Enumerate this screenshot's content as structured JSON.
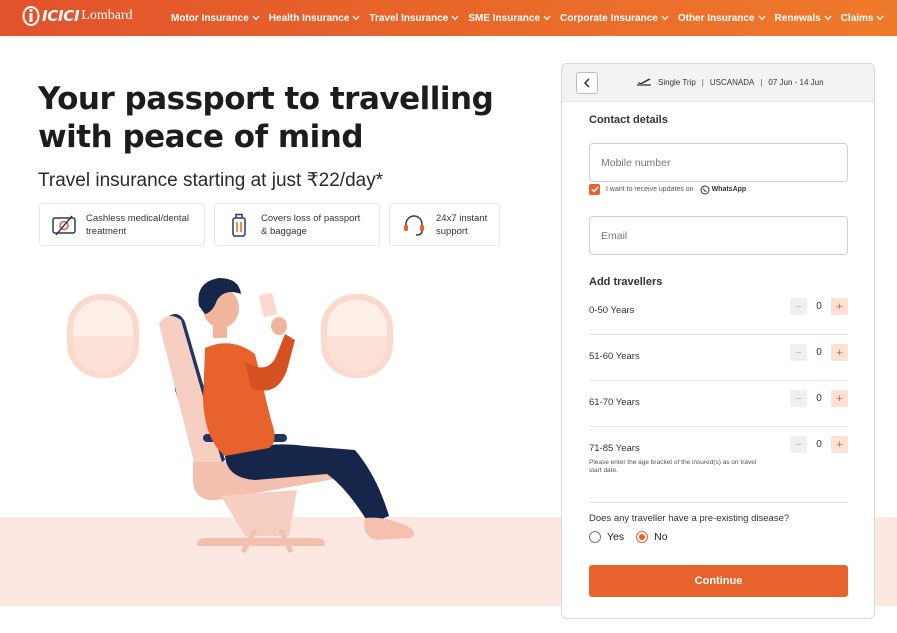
{
  "brand": {
    "name": "ICICI",
    "sub": "Lombard"
  },
  "nav": {
    "items": [
      {
        "label": "Motor Insurance"
      },
      {
        "label": "Health Insurance"
      },
      {
        "label": "Travel Insurance"
      },
      {
        "label": "SME Insurance"
      },
      {
        "label": "Corporate Insurance"
      },
      {
        "label": "Other Insurance"
      },
      {
        "label": "Renewals"
      },
      {
        "label": "Claims"
      }
    ]
  },
  "hero": {
    "title": "Your passport to travelling with peace of mind",
    "subtitle": "Travel insurance starting at just ₹22/day*",
    "features": [
      {
        "icon": "cashless-medical-icon",
        "text": "Cashless medical/dental treatment"
      },
      {
        "icon": "luggage-icon",
        "text": "Covers loss of passport & baggage"
      },
      {
        "icon": "headset-support-icon",
        "text": "24x7 instant support"
      }
    ]
  },
  "form": {
    "trip": {
      "type": "Single Trip",
      "destination": "USCANADA",
      "dates": "07 Jun - 14 Jun"
    },
    "contact_title": "Contact details",
    "mobile_placeholder": "Mobile number",
    "whatsapp_consent": "I want to receive updates on",
    "whatsapp_label": "WhatsApp",
    "email_placeholder": "Email",
    "travellers_title": "Add travellers",
    "travellers": [
      {
        "label": "0-50 Years",
        "count": "0",
        "note": ""
      },
      {
        "label": "51-60 Years",
        "count": "0",
        "note": ""
      },
      {
        "label": "61-70 Years",
        "count": "0",
        "note": ""
      },
      {
        "label": "71-85 Years",
        "count": "0",
        "note": "Please enter the age bracket of the insured(s) as on travel start date."
      }
    ],
    "question": "Does any traveller have a pre-existing disease?",
    "yes_label": "Yes",
    "no_label": "No",
    "selected": "No",
    "continue_label": "Continue"
  },
  "colors": {
    "accent": "#e8622b",
    "nav_start": "#e2522c",
    "band": "#fde8e1"
  }
}
